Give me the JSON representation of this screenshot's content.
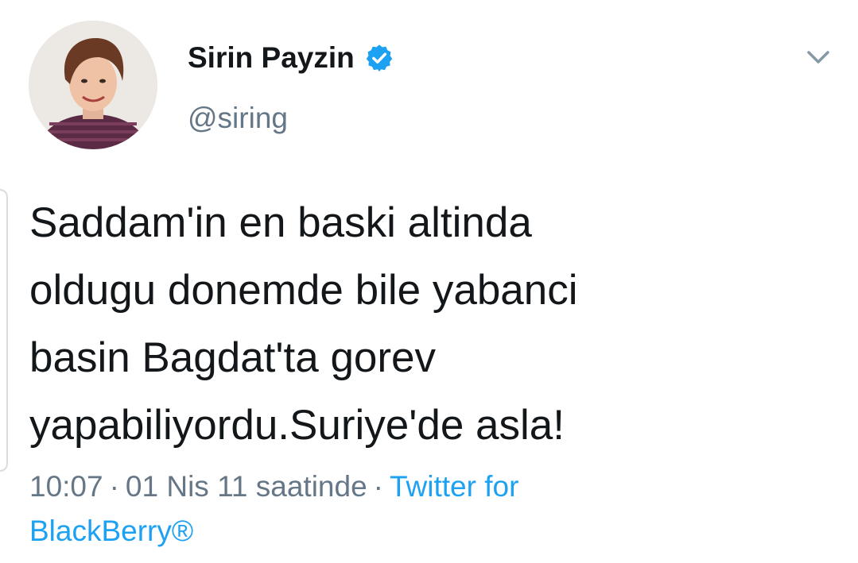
{
  "author": {
    "name": "Sirin Payzin",
    "handle": "@siring",
    "verified": true,
    "avatar_icon": "profile-photo"
  },
  "tweet": {
    "lines": [
      "Saddam'in en baski altinda",
      "oldugu donemde bile yabanci",
      "basin Bagdat'ta gorev",
      "yapabiliyordu.Suriye'de asla!"
    ]
  },
  "meta": {
    "time": "10:07",
    "separator": "·",
    "date_text": "01 Nis 11 saatinde",
    "source_line1": "Twitter for",
    "source_line2": "BlackBerry®"
  },
  "colors": {
    "text": "#14171a",
    "secondary": "#657786",
    "link": "#1da1f2",
    "verified_badge": "#1da1f2"
  },
  "icons": {
    "verified": "verified-badge-icon",
    "menu": "chevron-down-icon"
  }
}
